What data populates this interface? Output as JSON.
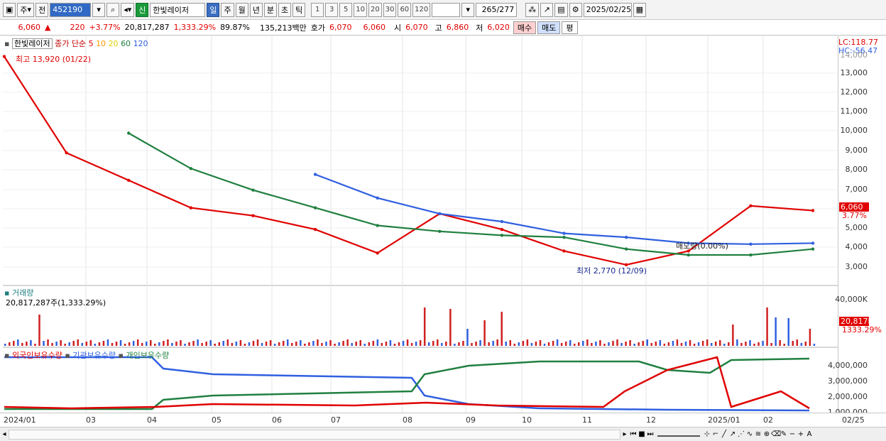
{
  "toolbar": {
    "market": "주",
    "prev_label": "전",
    "code": "452190",
    "stock_name": "한빛레이저",
    "new_badge": "신",
    "periods": [
      "일",
      "주",
      "월",
      "년",
      "분",
      "초",
      "틱"
    ],
    "active_period": "일",
    "intervals": [
      "1",
      "3",
      "5",
      "10",
      "20",
      "30",
      "60",
      "120"
    ],
    "count": "265",
    "count_total": "/277",
    "date": "2025/02/25"
  },
  "quote": {
    "price": "6,060",
    "change_arrow": "▲",
    "change": "220",
    "change_pct": "+3.77%",
    "volume": "20,817,287",
    "volume_pct": "1,333.29%",
    "turnover": "89.87%",
    "amount": "135,213백만",
    "ask_label": "호가",
    "ask": "6,070",
    "bid": "6,060",
    "open_label": "시",
    "open": "6,070",
    "high_label": "고",
    "high": "6,860",
    "low_label": "저",
    "low": "6,020",
    "buy_button": "매수",
    "sell_button": "매도",
    "eval_button": "평"
  },
  "price_panel": {
    "legend_name": "한빛레이저",
    "legend_type": "종가 단순",
    "ma_labels": [
      "5",
      "10",
      "20",
      "60",
      "120"
    ],
    "ma_colors": [
      "#e00000",
      "#ff9900",
      "#f0e000",
      "#208040",
      "#3060e0"
    ],
    "high_annot": "최고 13,920 (01/22)",
    "low_annot": "최저 2,770 (12/09)",
    "mid_annot": "매도량(0.00%)",
    "lc": "LC:118.77",
    "hc": "HC:-56.47",
    "top_label": "14,000",
    "yticks": [
      "13,000",
      "12,000",
      "11,000",
      "10,000",
      "9,000",
      "8,000",
      "7,000",
      "6,000",
      "5,000",
      "4,000",
      "3,000"
    ],
    "current_price_tag": "6,060",
    "current_pct_tag": "3.77%"
  },
  "volume_panel": {
    "title": "거래량",
    "value": "20,817,287주(1,333.29%)",
    "ytick": "40,000K",
    "tag": "20,817K",
    "tag_pct": "1333.29%"
  },
  "holding_panel": {
    "legend": [
      "외국인보유수량",
      "기관보유수량",
      "개인보유수량"
    ],
    "legend_colors": [
      "#e00000",
      "#3060e0",
      "#208040"
    ],
    "yticks": [
      "4,000,000",
      "3,000,000",
      "2,000,000",
      "1,000,000"
    ]
  },
  "xaxis": {
    "labels": [
      "2024/01",
      "03",
      "04",
      "05",
      "06",
      "07",
      "08",
      "09",
      "10",
      "11",
      "12",
      "2025/01",
      "02",
      "02/25"
    ]
  },
  "chart_data": {
    "type": "line",
    "title": "",
    "x": [
      "2024/01",
      "03",
      "04",
      "05",
      "06",
      "07",
      "08",
      "09",
      "10",
      "11",
      "12",
      "2025/01",
      "02",
      "02/25"
    ],
    "series": [
      {
        "name": "한빛레이저",
        "values": [
          13900,
          9000,
          7600,
          6200,
          5800,
          5100,
          3900,
          5900,
          5100,
          4000,
          3300,
          4000,
          6300,
          6060
        ]
      },
      {
        "name": "120",
        "values": [
          null,
          null,
          null,
          null,
          null,
          7900,
          6700,
          5900,
          5500,
          4900,
          4700,
          4400,
          4350,
          4400
        ]
      },
      {
        "name": "60",
        "values": [
          null,
          null,
          10000,
          8200,
          7100,
          6200,
          5300,
          5000,
          4800,
          4700,
          4100,
          3800,
          3800,
          4100
        ]
      }
    ],
    "ylim": [
      2500,
      14500
    ]
  }
}
